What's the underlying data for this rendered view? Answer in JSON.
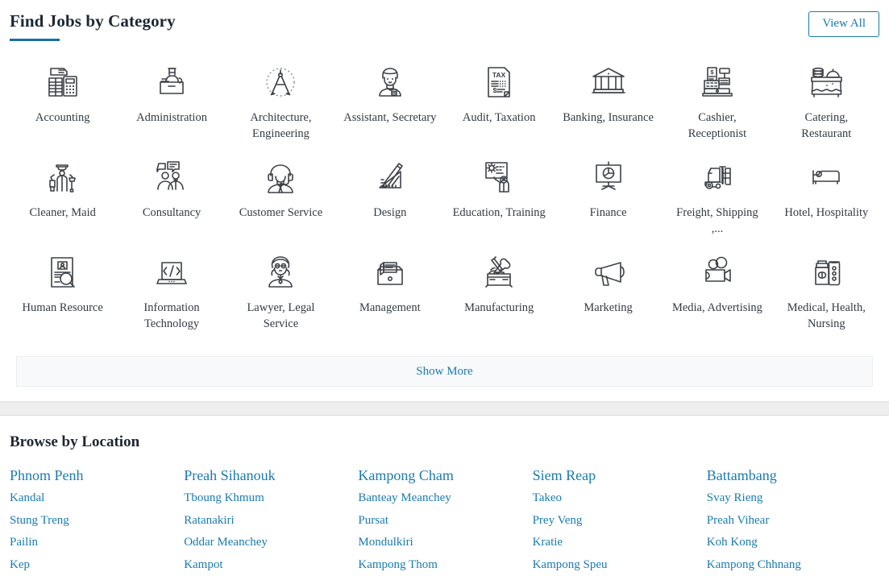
{
  "categories_section": {
    "title": "Find Jobs by Category",
    "view_all_label": "View All",
    "show_more_label": "Show More",
    "accent_color": "#1a7bb0",
    "title_rule_color": "#1a6fa3",
    "items": [
      {
        "label": "Accounting",
        "icon": "documents-calculator-icon"
      },
      {
        "label": "Administration",
        "icon": "reception-desk-icon"
      },
      {
        "label": "Architecture, Engineering",
        "icon": "drafting-compass-icon"
      },
      {
        "label": "Assistant, Secretary",
        "icon": "secretary-person-icon"
      },
      {
        "label": "Audit, Taxation",
        "icon": "tax-document-icon"
      },
      {
        "label": "Banking, Insurance",
        "icon": "bank-building-icon"
      },
      {
        "label": "Cashier, Receptionist",
        "icon": "cash-register-icon"
      },
      {
        "label": "Catering, Restaurant",
        "icon": "catering-table-icon"
      },
      {
        "label": "Cleaner, Maid",
        "icon": "cleaner-tools-icon"
      },
      {
        "label": "Consultancy",
        "icon": "two-people-chat-icon"
      },
      {
        "label": "Customer Service",
        "icon": "headset-agent-icon"
      },
      {
        "label": "Design",
        "icon": "ruler-pencil-icon"
      },
      {
        "label": "Education, Training",
        "icon": "whiteboard-teacher-icon"
      },
      {
        "label": "Finance",
        "icon": "pie-chart-presentation-icon"
      },
      {
        "label": "Freight, Shipping ,...",
        "icon": "forklift-icon"
      },
      {
        "label": "Hotel, Hospitality",
        "icon": "bed-icon"
      },
      {
        "label": "Human Resource",
        "icon": "resume-search-icon"
      },
      {
        "label": "Information Technology",
        "icon": "laptop-code-icon"
      },
      {
        "label": "Lawyer, Legal Service",
        "icon": "judge-wig-icon"
      },
      {
        "label": "Management",
        "icon": "file-drawer-icon"
      },
      {
        "label": "Manufacturing",
        "icon": "toolbox-icon"
      },
      {
        "label": "Marketing",
        "icon": "megaphone-icon"
      },
      {
        "label": "Media, Advertising",
        "icon": "film-camera-icon"
      },
      {
        "label": "Medical, Health, Nursing",
        "icon": "medicine-pills-icon"
      }
    ]
  },
  "locations_section": {
    "title": "Browse by Location",
    "columns": [
      {
        "items": [
          "Phnom Penh",
          "Kandal",
          "Stung Treng",
          "Pailin",
          "Kep"
        ]
      },
      {
        "items": [
          "Preah Sihanouk",
          "Tboung Khmum",
          "Ratanakiri",
          "Oddar Meanchey",
          "Kampot"
        ]
      },
      {
        "items": [
          "Kampong Cham",
          "Banteay Meanchey",
          "Pursat",
          "Mondulkiri",
          "Kampong Thom"
        ]
      },
      {
        "items": [
          "Siem Reap",
          "Takeo",
          "Prey Veng",
          "Kratie",
          "Kampong Speu"
        ]
      },
      {
        "items": [
          "Battambang",
          "Svay Rieng",
          "Preah Vihear",
          "Koh Kong",
          "Kampong Chhnang"
        ]
      }
    ]
  }
}
